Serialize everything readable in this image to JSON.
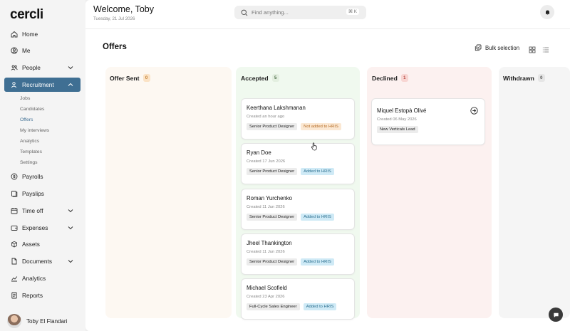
{
  "app": {
    "logo": "cercli"
  },
  "sidebar": {
    "items": [
      {
        "label": "Home",
        "icon": "home-icon"
      },
      {
        "label": "Me",
        "icon": "user-circle-icon"
      },
      {
        "label": "People",
        "icon": "people-icon"
      },
      {
        "label": "Recruitment",
        "icon": "recruitment-icon"
      },
      {
        "label": "Payrolls",
        "icon": "payroll-icon"
      },
      {
        "label": "Payslips",
        "icon": "payslip-icon"
      },
      {
        "label": "Time off",
        "icon": "calendar-icon"
      },
      {
        "label": "Expenses",
        "icon": "wallet-icon"
      },
      {
        "label": "Assets",
        "icon": "box-icon"
      },
      {
        "label": "Documents",
        "icon": "document-icon"
      },
      {
        "label": "Analytics",
        "icon": "chart-icon"
      },
      {
        "label": "Reports",
        "icon": "report-icon"
      }
    ],
    "recruitment_sub": [
      "Jobs",
      "Candidates",
      "Offers",
      "My interviews",
      "Analytics",
      "Templates",
      "Settings"
    ],
    "active_sub": "Offers"
  },
  "user": {
    "name": "Toby El Flandari"
  },
  "header": {
    "greeting": "Welcome, Toby",
    "date": "Tuesday, 21 Jul 2026",
    "search_placeholder": "Find anything...",
    "search_shortcut": "⌘ K"
  },
  "page": {
    "title": "Offers",
    "bulk_label": "Bulk selection"
  },
  "columns": [
    {
      "title": "Offer Sent",
      "count": "0",
      "color": "#fdf8f2",
      "badge_bg": "#fbe3c6",
      "badge_fg": "#c07a2a",
      "cards": []
    },
    {
      "title": "Accepted",
      "count": "5",
      "color": "#f0f9ef",
      "badge_bg": "#e3efe0",
      "badge_fg": "#4a6b46",
      "cards": [
        {
          "name": "Keerthana Lakshmanan",
          "created": "Created an hour ago",
          "role": "Senior Product Designer",
          "hris": "Not added to HRIS",
          "hris_added": false
        },
        {
          "name": "Ryan Doe",
          "created": "Created 17 Jun 2026",
          "role": "Senior Product Designer",
          "hris": "Added to HRIS",
          "hris_added": true
        },
        {
          "name": "Roman Yurchenko",
          "created": "Created 11 Jun 2026",
          "role": "Senior Product Designer",
          "hris": "Added to HRIS",
          "hris_added": true
        },
        {
          "name": "Jheel Thankington",
          "created": "Created 11 Jun 2026",
          "role": "Senior Product Designer",
          "hris": "Added to HRIS",
          "hris_added": true
        },
        {
          "name": "Michael Scofield",
          "created": "Created 23 Apr 2026",
          "role": "Full-Cycle Sales Engineer",
          "hris": "Added to HRIS",
          "hris_added": true
        }
      ]
    },
    {
      "title": "Declined",
      "count": "1",
      "color": "#fcf1f0",
      "badge_bg": "#f8d6d3",
      "badge_fg": "#b4453d",
      "cards": [
        {
          "name": "Miquel Estopà Olivé",
          "created": "Created 06 May 2026",
          "role": "New Verticals Lead"
        }
      ]
    },
    {
      "title": "Withdrawn",
      "count": "0",
      "color": "#f5f5f5",
      "badge_bg": "#e6e6e6",
      "badge_fg": "#555",
      "cards": []
    }
  ]
}
